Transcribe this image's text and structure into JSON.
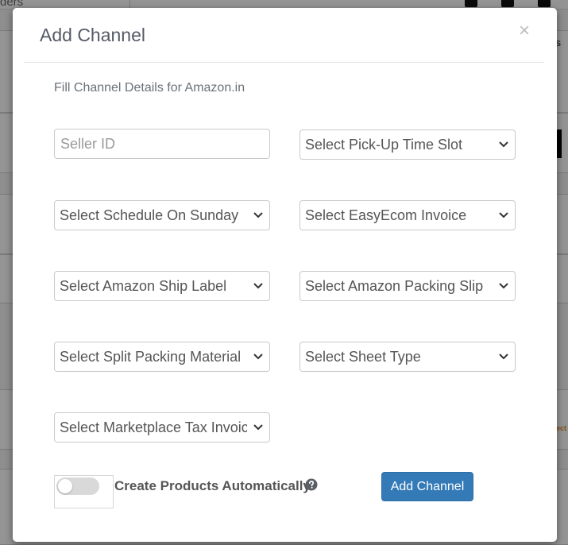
{
  "background": {
    "crumb_text": "ders",
    "right_header_letter": "s",
    "right_orange_text": "ect"
  },
  "modal": {
    "title": "Add Channel",
    "close_glyph": "×",
    "subtitle": "Fill Channel Details for Amazon.in",
    "seller_id": {
      "placeholder": "Seller ID",
      "value": ""
    },
    "selects": {
      "pickup_time_slot": "Select Pick-Up Time Slot",
      "schedule_on_sunday": "Select Schedule On Sunday",
      "easyecom_invoice": "Select EasyEcom Invoice",
      "amazon_ship_label": "Select Amazon Ship Label",
      "amazon_packing_slip": "Select Amazon Packing Slip",
      "split_packing_material": "Select Split Packing Material",
      "sheet_type": "Select Sheet Type",
      "marketplace_tax_invoice": "Select Marketplace Tax Invoice"
    },
    "create_products_toggle": {
      "label": "Create Products Automatically",
      "on": false
    },
    "help_icon": "question-circle-icon",
    "submit_label": "Add Channel"
  },
  "colors": {
    "primary": "#337ab7",
    "title": "#555b66",
    "overlay": "rgba(0,0,0,0.42)"
  }
}
